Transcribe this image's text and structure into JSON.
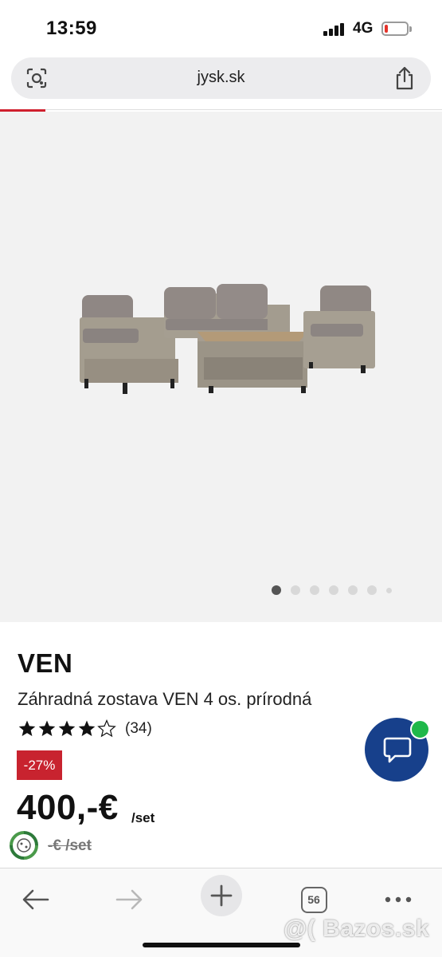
{
  "status_bar": {
    "time": "13:59",
    "network": "4G",
    "battery_level": 0.15,
    "battery_color": "#e5332a"
  },
  "browser": {
    "url": "jysk.sk",
    "lens_icon": "camera-lens-icon",
    "share_icon": "share-icon"
  },
  "gallery": {
    "image_count": 7,
    "active_index": 0
  },
  "product": {
    "name": "VEN",
    "description": "Záhradná zostava VEN 4 os. prírodná",
    "rating": 4.5,
    "rating_max": 5,
    "review_count": "(34)",
    "discount": "-27%",
    "price": "400,-€",
    "price_unit": "/set",
    "old_price": "-€ /set"
  },
  "chat": {
    "icon": "chat-bubble-icon",
    "status_color": "#1fb84a"
  },
  "toolbar": {
    "tab_count": "56",
    "icons": [
      "back-arrow-icon",
      "forward-arrow-icon",
      "plus-icon",
      "tabs-icon",
      "more-icon"
    ]
  },
  "watermark": "@( Bazos.sk",
  "colors": {
    "brand_blue": "#17408b",
    "sale_red": "#c8232f"
  }
}
